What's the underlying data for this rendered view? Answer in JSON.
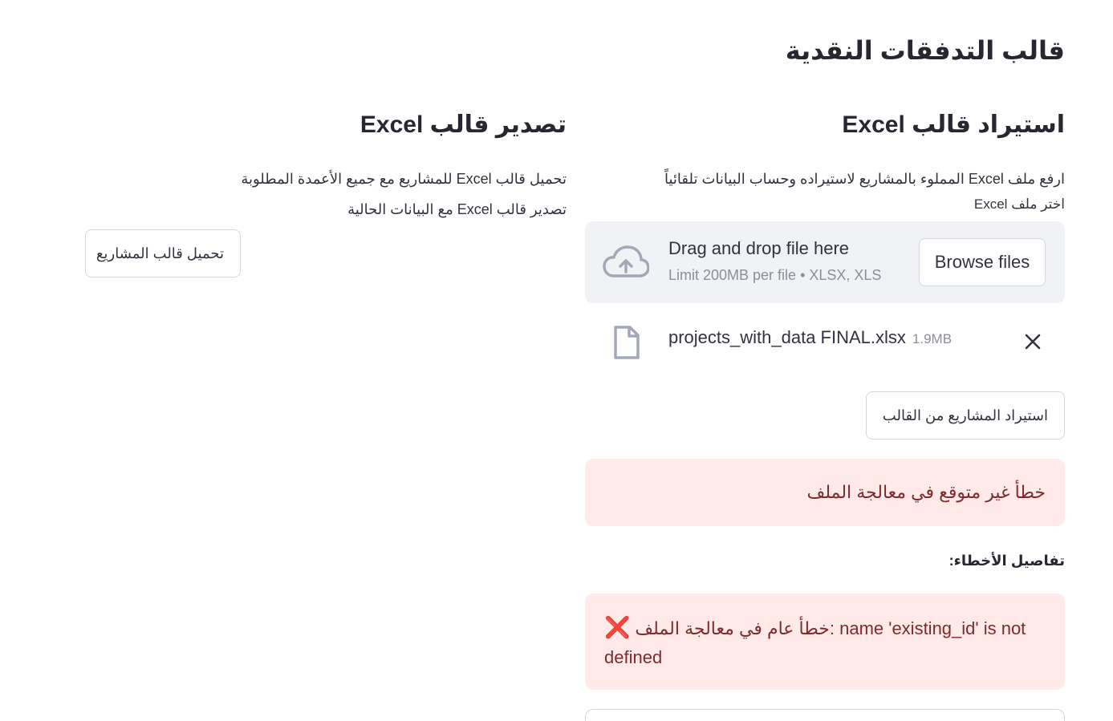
{
  "page": {
    "title": "قالب التدفقات النقدية"
  },
  "import_section": {
    "title": "استيراد قالب Excel",
    "description": "ارفع ملف Excel المملوء بالمشاريع لاستيراده وحساب البيانات تلقائياً",
    "uploader_label": "اختر ملف Excel",
    "dropzone": {
      "main_text": "Drag and drop file here",
      "sub_text": "Limit 200MB per file • XLSX, XLS",
      "browse_label": "Browse files",
      "icon": "cloud-upload-icon"
    },
    "uploaded_file": {
      "name": "projects_with_data FINAL.xlsx",
      "size": "1.9MB",
      "icon": "file-icon",
      "remove_icon": "close-icon"
    },
    "import_button": "استيراد المشاريع من القالب",
    "error_alert": "خطأ غير متوقع في معالجة الملف",
    "details_label": "تفاصيل الأخطاء:",
    "details_alert": {
      "icon": "❌",
      "message": "خطأ عام في معالجة الملف: name 'existing_id' is not defined"
    }
  },
  "export_section": {
    "title": "تصدير قالب Excel",
    "line_1": "تحميل قالب Excel للمشاريع مع جميع الأعمدة المطلوبة",
    "line_2": "تصدير قالب Excel مع البيانات الحالية",
    "download_button": "تحميل قالب المشاريع"
  },
  "colors": {
    "error_bg": "#ffe9e9",
    "error_text": "#7d2b2b",
    "dropzone_bg": "#f0f2f6",
    "icon_gray": "#a3a8b8",
    "x_red": "#e8334b"
  }
}
